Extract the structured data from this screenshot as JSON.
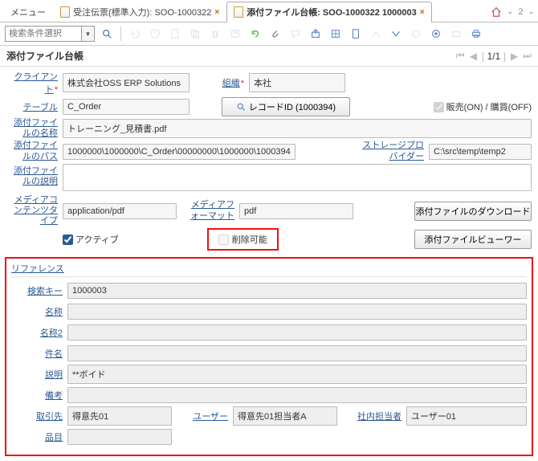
{
  "tabs": {
    "menu": "メニュー",
    "order": "受注伝票(標準入力): SOO-1000322",
    "attach": "添付ファイル台帳: SOO-1000322 1000003",
    "count_indicator": "2"
  },
  "toolbar": {
    "search_placeholder": "検索条件選択"
  },
  "title": "添付ファイル台帳",
  "pager": {
    "pos": "1/1"
  },
  "fields": {
    "client_label": "クライアント",
    "client": "株式会社OSS ERP Solutions",
    "org_label": "組織",
    "org": "本社",
    "table_label": "テーブル",
    "table": "C_Order",
    "record_btn": "レコードID (1000394)",
    "sales_label": "販売(ON) / 購買(OFF)",
    "filename_label": "添付ファイルの名称",
    "filename": "トレーニング_見積書.pdf",
    "path_label": "添付ファイルのパス",
    "path": "1000000\\1000000\\C_Order\\00000000\\1000000\\1000394",
    "storage_label": "ストレージプロバイダー",
    "storage": "C:\\src\\temp\\temp2",
    "desc_label": "添付ファイルの説明",
    "desc": "",
    "mediact_label": "メディアコンテンツタイプ",
    "mediact": "application/pdf",
    "mediafmt_label": "メディアフォーマット",
    "mediafmt": "pdf",
    "download_btn": "添付ファイルのダウンロード",
    "active_label": "アクティブ",
    "deletable_label": "削除可能",
    "viewer_btn": "添付ファイルビューワー"
  },
  "ref": {
    "title": "リファレンス",
    "searchkey_label": "検索キー",
    "searchkey": "1000003",
    "name_label": "名称",
    "name": "",
    "name2_label": "名称2",
    "name2": "",
    "subject_label": "件名",
    "subject": "",
    "desc_label": "説明",
    "desc": "**ボイド",
    "note_label": "備考",
    "note": "",
    "bp_label": "取引先",
    "bp": "得意先01",
    "user_label": "ユーザー",
    "user": "得意先01担当者A",
    "srep_label": "社内担当者",
    "srep": "ユーザー01",
    "item_label": "品目"
  }
}
